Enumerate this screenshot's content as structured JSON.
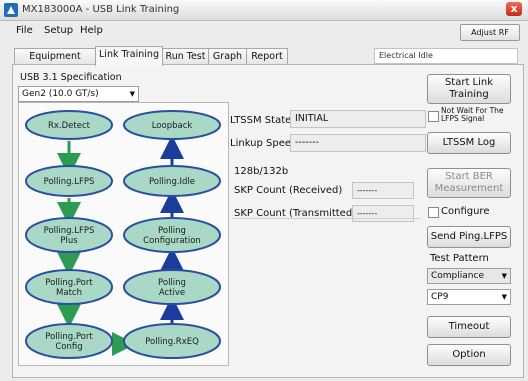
{
  "window": {
    "title": "MX183000A - USB Link Training",
    "close_glyph": "x"
  },
  "menu": [
    "File",
    "Setup",
    "Help"
  ],
  "adjust_rf_label": "Adjust RF",
  "tabs": [
    "Equipment Setup",
    "Link Training",
    "Run Test",
    "Graph",
    "Report"
  ],
  "active_tab": "Link Training",
  "status_text": "Electrical Idle",
  "spec": {
    "label": "USB 3.1 Specification",
    "value": "Gen2 (10.0 GT/s)"
  },
  "ltssm": {
    "state_label": "LTSSM State",
    "state_value": "INITIAL",
    "speed_label": "Linkup Speed",
    "speed_value": "-------"
  },
  "encoding_label": "128b/132b",
  "skp": {
    "received_label": "SKP Count (Received)",
    "transmitted_label": "SKP Count (Transmitted)",
    "received_value": "-------",
    "transmitted_value": "-------"
  },
  "buttons": {
    "start_link": "Start Link Training",
    "no_wait": "Not Wait For The LFPS Signal",
    "ltssm_log": "LTSSM Log",
    "start_ber": "Start BER Measurement",
    "configure": "Configure",
    "send_ping": "Send Ping.LFPS",
    "timeout": "Timeout",
    "option": "Option"
  },
  "test_pattern": {
    "label": "Test Pattern",
    "value1": "Compliance",
    "value2": "CP9"
  },
  "states_left": [
    "Rx.Detect",
    "Polling.LFPS",
    "Polling.LFPS Plus",
    "Polling.Port Match",
    "Polling.Port Config"
  ],
  "states_right": [
    "Loopback",
    "Polling.Idle",
    "Polling Configuration",
    "Polling Active",
    "Polling.RxEQ"
  ],
  "colors": {
    "node_fill": "#a9d8c6",
    "node_stroke": "#2b4fa0",
    "arrow_left": "#2e9b55",
    "arrow_right": "#1c3d9c"
  }
}
